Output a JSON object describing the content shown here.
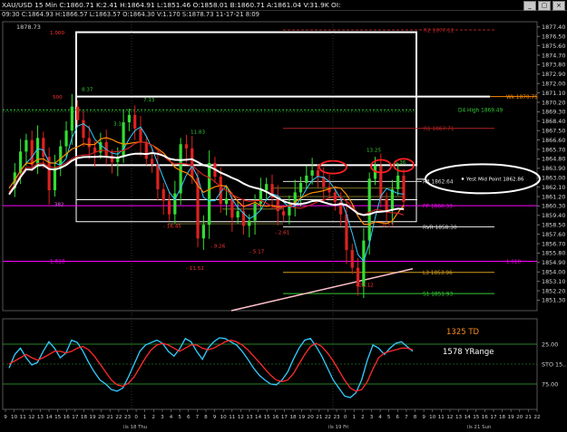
{
  "window": {
    "title": "XAU/USD  15 Min  C:1860.71  K:2.41  H:1864.91  L:1851.46  O:1858.01  B:1860.71  A:1861.04  V:31.9K  OI:",
    "subtitle": "09:30  C:1864.93  H:1866.57  L:1863.57  O:1864.30  V:1.170  S:1878.73  11-17-21  8:09",
    "buttons": [
      "_",
      "▢",
      "×"
    ]
  },
  "chart_data": [
    {
      "type": "line",
      "series_name": "XAU/USD 15 Min",
      "ylim": [
        1850.3,
        1877.9
      ],
      "y_ticks": [
        "1877.40",
        "1876.50",
        "1875.60",
        "1874.70",
        "1873.80",
        "1872.90",
        "1872.00",
        "1871.10",
        "1870.20",
        "1869.30",
        "1868.40",
        "1867.50",
        "1866.60",
        "1865.70",
        "1864.80",
        "1863.90",
        "1863.00",
        "1862.10",
        "1861.20",
        "1860.30",
        "1859.40",
        "1858.50",
        "1857.60",
        "1856.70",
        "1855.80",
        "1854.90",
        "1854.00",
        "1853.10",
        "1852.20",
        "1851.30"
      ],
      "x_ticks": [
        "9",
        "10",
        "11",
        "12",
        "13",
        "14",
        "15",
        "16",
        "17",
        "18",
        "19",
        "20",
        "21",
        "22",
        "23",
        "0",
        "1",
        "2",
        "3",
        "4",
        "5",
        "6",
        "7",
        "8",
        "9",
        "10",
        "11",
        "12",
        "13",
        "14",
        "15",
        "16",
        "17",
        "18",
        "19",
        "20",
        "21",
        "22",
        "23",
        "0",
        "1",
        "2",
        "3",
        "4",
        "5",
        "6",
        "7",
        "8",
        "9",
        "10",
        "11",
        "12",
        "13",
        "14",
        "15",
        "16",
        "17",
        "18",
        "19",
        "20",
        "21",
        "22"
      ],
      "x_dates": [
        "ils 18 Thu",
        "ils 19 Fri",
        "ils 21 Sun"
      ],
      "top_left_value": "1878.73",
      "levels": [
        {
          "label": "R2 1877.12",
          "value": 1877.12,
          "color": "#b22222"
        },
        {
          "label": "Wk 1870.75",
          "value": 1870.75,
          "color": "#ff8c00"
        },
        {
          "label": "D4 High 1869.49",
          "value": 1869.49,
          "color": "#33cc33"
        },
        {
          "label": "R1 1867.71",
          "value": 1867.71,
          "color": "#b22222"
        },
        {
          "label": "R3 1862.64",
          "value": 1862.64,
          "color": "#dddddd"
        },
        {
          "label": "PP 1860.33",
          "value": 1860.33,
          "color": "#ff00ff"
        },
        {
          "label": "RVR 1858.30",
          "value": 1858.3,
          "color": "#dddddd"
        },
        {
          "label": "1.618",
          "value": 1855.02,
          "color": "#ff00ff"
        },
        {
          "label": "L3 1853.96",
          "value": 1853.96,
          "color": "#d4a017"
        },
        {
          "label": "S1 1851.93",
          "value": 1851.93,
          "color": "#33cc33"
        }
      ],
      "fib_labels": [
        "1.000",
        "500",
        ".382",
        "1.618"
      ],
      "annotations": [
        {
          "text": "Yest Mid Point 1862.86",
          "type": "callout"
        },
        {
          "text": "8.37"
        },
        {
          "text": "7.13"
        },
        {
          "text": "3.14"
        },
        {
          "text": "11.83"
        },
        {
          "text": "13.25"
        },
        {
          "text": "5.36"
        },
        {
          "text": "- 16.45"
        },
        {
          "text": "- 9.26"
        },
        {
          "text": "- 5.17"
        },
        {
          "text": "- 11.52"
        },
        {
          "text": "- 2.61"
        },
        {
          "text": "- 22.12"
        },
        {
          "text": "- 8.17"
        }
      ],
      "price_path": [
        1862.0,
        1863.5,
        1865.5,
        1866.6,
        1864.2,
        1866.8,
        1865.0,
        1861.8,
        1864.0,
        1866.0,
        1867.5,
        1869.8,
        1868.5,
        1866.8,
        1865.9,
        1865.4,
        1866.4,
        1865.1,
        1864.5,
        1865.0,
        1868.3,
        1869.0,
        1867.7,
        1866.4,
        1864.8,
        1864.3,
        1861.9,
        1860.8,
        1859.5,
        1861.5,
        1866.2,
        1865.8,
        1863.0,
        1857.2,
        1858.5,
        1864.4,
        1863.1,
        1860.5,
        1861.0,
        1859.2,
        1859.8,
        1858.4,
        1858.9,
        1860.5,
        1861.8,
        1862.4,
        1861.1,
        1859.8,
        1859.4,
        1860.4,
        1861.6,
        1862.5,
        1863.2,
        1863.7,
        1863.1,
        1862.1,
        1861.6,
        1860.7,
        1859.5,
        1856.1,
        1854.4,
        1852.6,
        1857.0,
        1862.9,
        1864.1,
        1861.0,
        1859.9,
        1861.9,
        1863.2,
        1860.7
      ]
    },
    {
      "type": "line",
      "series_name": "STO 15 Min",
      "ylim": [
        0,
        100
      ],
      "y_ticks": [
        "25.00",
        "STO 15..",
        "75.00"
      ],
      "annotations": [
        {
          "text": "1325 TD",
          "color": "#ff8c1a"
        },
        {
          "text": "1578 YRange",
          "color": "#ffffff"
        }
      ],
      "series": [
        {
          "name": "K",
          "color": "#33ccff",
          "values": [
            45,
            62,
            70,
            58,
            49,
            52,
            66,
            78,
            70,
            58,
            64,
            80,
            77,
            66,
            52,
            40,
            30,
            25,
            18,
            16,
            20,
            34,
            50,
            66,
            74,
            77,
            80,
            76,
            66,
            60,
            69,
            82,
            78,
            66,
            56,
            70,
            78,
            83,
            82,
            78,
            74,
            66,
            56,
            45,
            36,
            30,
            25,
            24,
            30,
            40,
            56,
            70,
            80,
            82,
            72,
            60,
            45,
            30,
            20,
            10,
            8,
            14,
            30,
            55,
            74,
            70,
            62,
            70,
            76,
            78,
            72,
            66
          ]
        },
        {
          "name": "D",
          "color": "#ff2a2a",
          "values": [
            50,
            54,
            58,
            62,
            58,
            55,
            58,
            62,
            66,
            66,
            64,
            66,
            70,
            72,
            68,
            60,
            50,
            40,
            30,
            24,
            22,
            26,
            34,
            46,
            58,
            68,
            74,
            76,
            74,
            70,
            66,
            70,
            74,
            74,
            70,
            68,
            70,
            74,
            78,
            80,
            78,
            74,
            68,
            60,
            52,
            44,
            36,
            30,
            28,
            30,
            38,
            50,
            62,
            72,
            76,
            72,
            64,
            54,
            42,
            30,
            20,
            16,
            18,
            28,
            44,
            58,
            64,
            66,
            68,
            70,
            70,
            68
          ]
        }
      ]
    }
  ]
}
